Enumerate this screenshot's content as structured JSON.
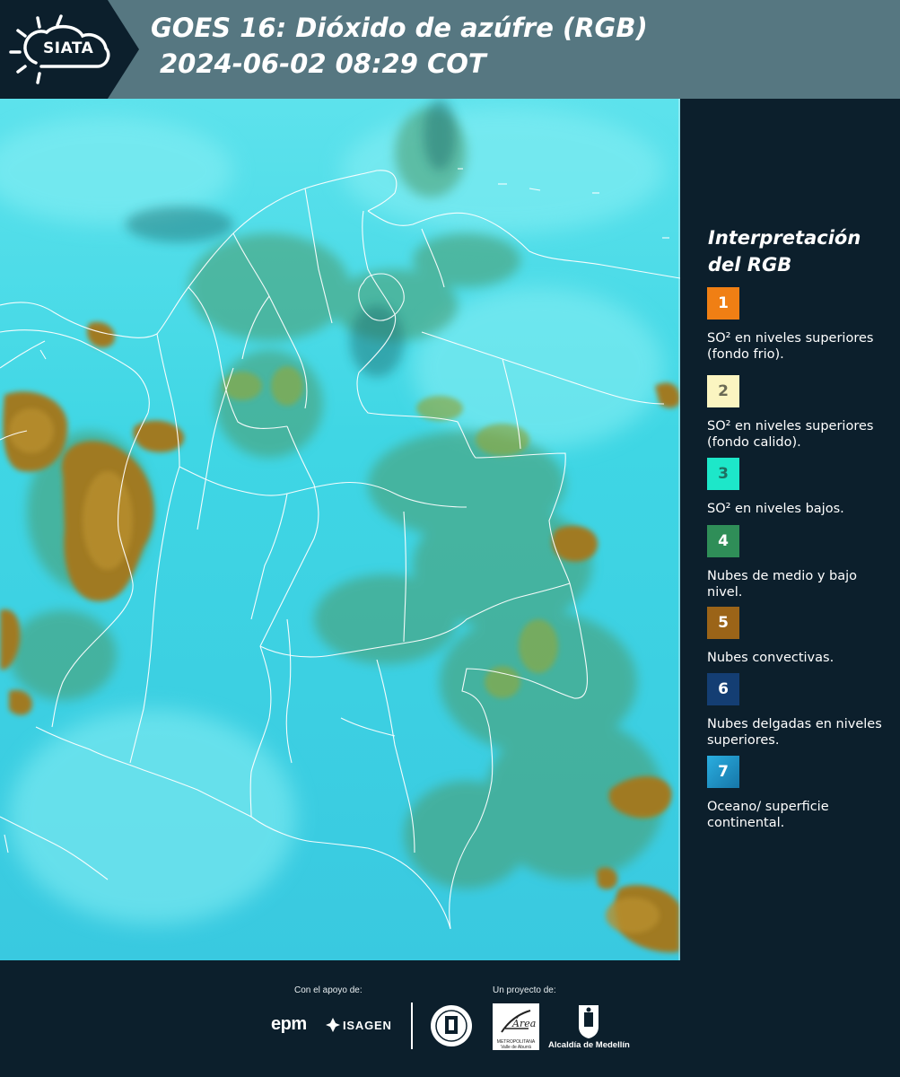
{
  "header": {
    "logo_text": "SIATA",
    "title_line1": "GOES 16: Dióxido de azúfre (RGB)",
    "title_line2": "2024-06-02 08:29 COT"
  },
  "legend": {
    "title": "Interpretación del RGB",
    "items": [
      {
        "number": "1",
        "label": "SO² en niveles superiores (fondo frio).",
        "color": "#f07f14",
        "text_color": "#ffffff"
      },
      {
        "number": "2",
        "label": "SO² en niveles superiores (fondo calido).",
        "color": "#fbf5c1",
        "text_color": "#6b6b55"
      },
      {
        "number": "3",
        "label": "SO² en niveles bajos.",
        "color": "#1de7c9",
        "text_color": "#1f6f61"
      },
      {
        "number": "4",
        "label": "Nubes de medio y bajo nivel.",
        "color": "#2f8e58",
        "text_color": "#ffffff"
      },
      {
        "number": "5",
        "label": "Nubes convectivas.",
        "color": "#9b6418",
        "text_color": "#ffffff"
      },
      {
        "number": "6",
        "label": "Nubes delgadas en niveles superiores.",
        "color": "#143e73",
        "text_color": "#ffffff"
      },
      {
        "number": "7",
        "label": "Oceano/ superficie continental.",
        "color": "#1c8ec8",
        "text_color": "#ffffff"
      }
    ]
  },
  "footer": {
    "support_label": "Con el apoyo de:",
    "project_label": "Un proyecto de:",
    "epm": "epm",
    "isagen": "ISAGEN",
    "area_logo_text": "METROPOLITANA Valle de Aburrá",
    "alcaldia": "Alcaldía de Medellín"
  },
  "colors": {
    "header_bg": "#567781",
    "panel_bg": "#0c1f2c",
    "map_base": "#3fd1e1",
    "convective": "#a07a22",
    "mid_low": "#4c9a6a"
  },
  "icons": [
    "sun-logo-icon",
    "isagen-mark-icon",
    "medellin-seal-icon",
    "area-metropolitana-logo-icon",
    "alcaldia-shield-icon"
  ]
}
